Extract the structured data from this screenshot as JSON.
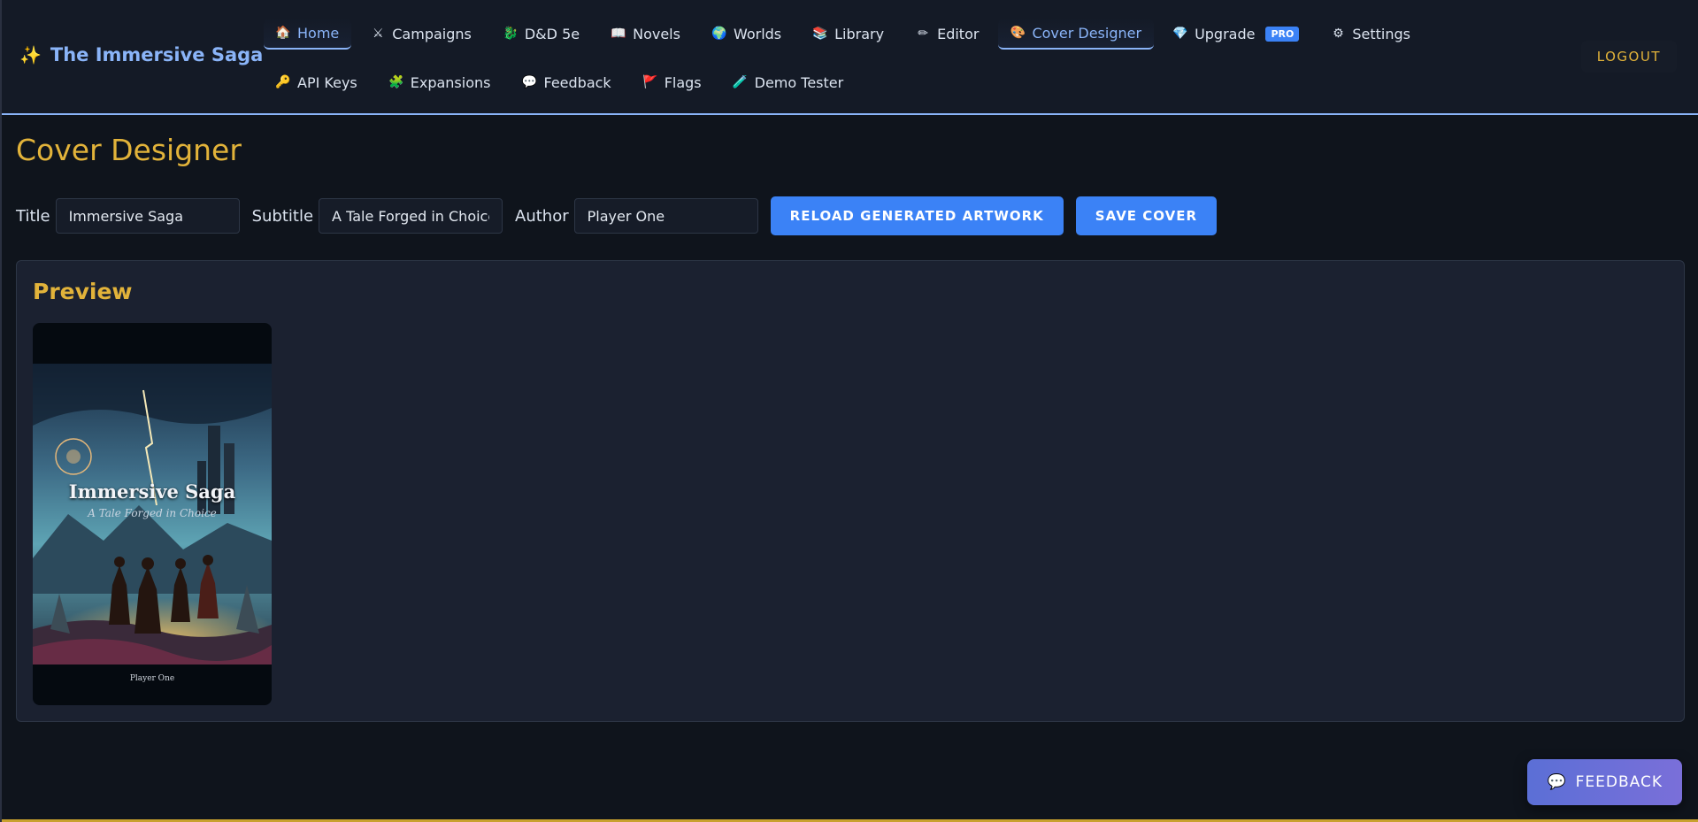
{
  "app": {
    "brand": "The Immersive Saga",
    "brand_icon": "sparkles-icon"
  },
  "nav": {
    "row1": [
      {
        "label": "Home",
        "icon": "home-icon",
        "glyph": "🏠",
        "active": true
      },
      {
        "label": "Campaigns",
        "icon": "swords-icon",
        "glyph": "⚔"
      },
      {
        "label": "D&D 5e",
        "icon": "dragon-icon",
        "glyph": "🐉"
      },
      {
        "label": "Novels",
        "icon": "book-icon",
        "glyph": "📖"
      },
      {
        "label": "Worlds",
        "icon": "globe-icon",
        "glyph": "🌍"
      },
      {
        "label": "Library",
        "icon": "books-icon",
        "glyph": "📚"
      },
      {
        "label": "Editor",
        "icon": "pencil-icon",
        "glyph": "✏"
      },
      {
        "label": "Cover Designer",
        "icon": "palette-icon",
        "glyph": "🎨",
        "active": true
      },
      {
        "label": "Upgrade",
        "icon": "gem-icon",
        "glyph": "💎",
        "badge": "PRO"
      },
      {
        "label": "Settings",
        "icon": "gear-icon",
        "glyph": "⚙"
      }
    ],
    "row2": [
      {
        "label": "API Keys",
        "icon": "key-icon",
        "glyph": "🔑"
      },
      {
        "label": "Expansions",
        "icon": "puzzle-icon",
        "glyph": "🧩"
      },
      {
        "label": "Feedback",
        "icon": "speech-bubble-icon",
        "glyph": "💬"
      },
      {
        "label": "Flags",
        "icon": "flag-icon",
        "glyph": "🚩"
      },
      {
        "label": "Demo Tester",
        "icon": "test-tube-icon",
        "glyph": "🧪"
      }
    ],
    "logout": "LOGOUT"
  },
  "page": {
    "title": "Cover Designer"
  },
  "form": {
    "title_label": "Title",
    "title_value": "Immersive Saga",
    "subtitle_label": "Subtitle",
    "subtitle_value": "A Tale Forged in Choice",
    "author_label": "Author",
    "author_value": "Player One",
    "reload_button": "RELOAD GENERATED ARTWORK",
    "save_button": "SAVE COVER"
  },
  "preview": {
    "heading": "Preview",
    "cover_title": "Immersive Saga",
    "cover_subtitle": "A Tale Forged in Choice",
    "cover_author": "Player One"
  },
  "fab": {
    "label": "FEEDBACK",
    "icon": "speech-bubble-icon"
  },
  "colors": {
    "accent": "#3b82f6",
    "gold": "#e2b33a",
    "link": "#8ab4f8",
    "bg": "#0f141c"
  }
}
